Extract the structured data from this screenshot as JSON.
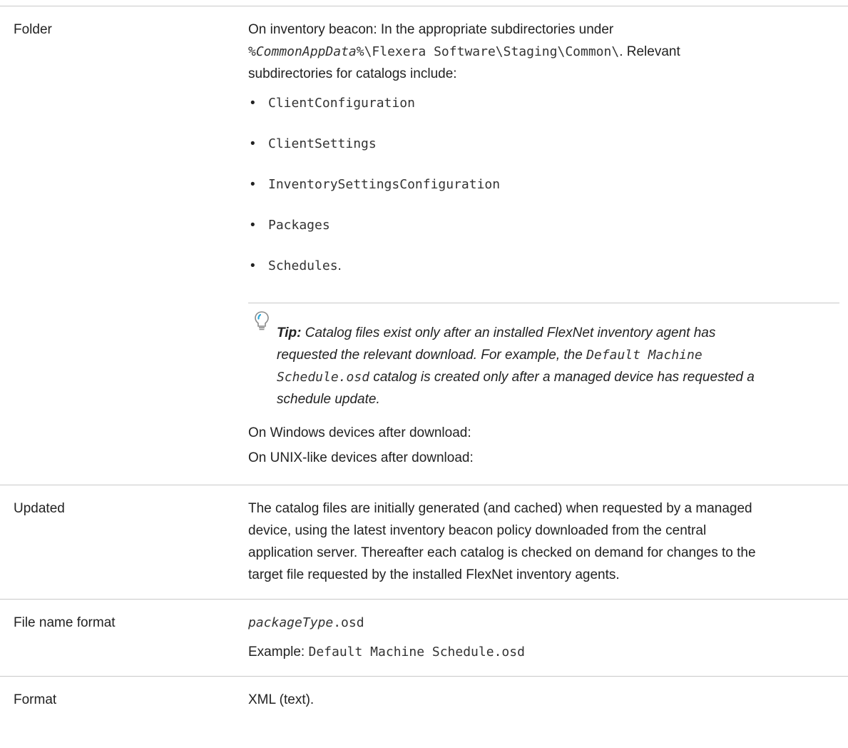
{
  "rows": {
    "folder": {
      "label": "Folder",
      "intro_prefix": "On inventory beacon: In the appropriate subdirectories under",
      "path_var": "%CommonAppData%",
      "path_rest": "\\Flexera Software\\Staging\\Common\\",
      "intro_suffix": ". Relevant",
      "intro_line3": "subdirectories for catalogs include:",
      "subdirs": [
        "ClientConfiguration",
        "ClientSettings",
        "InventorySettingsConfiguration",
        "Packages",
        "Schedules"
      ],
      "last_suffix": ".",
      "tip": {
        "icon": "lightbulb-icon",
        "label": "Tip:",
        "text1": "Catalog files exist only after an installed FlexNet inventory agent has",
        "text2": "requested the relevant download. For example, the",
        "code1": "Default Machine",
        "code2": "Schedule.osd",
        "text3": "catalog is created only after a managed device has requested a",
        "text4": "schedule update."
      },
      "windows_line": "On Windows devices after download:",
      "unix_line": "On UNIX-like devices after download:"
    },
    "updated": {
      "label": "Updated",
      "lines": [
        "The catalog files are initially generated (and cached) when requested by a managed",
        "device, using the latest inventory beacon policy downloaded from the central",
        "application server. Thereafter each catalog is checked on demand for changes to the",
        "target file requested by the installed FlexNet inventory agents."
      ]
    },
    "file_name_format": {
      "label": "File name format",
      "var": "packageType",
      "ext": ".osd",
      "example_label": "Example:",
      "example_value": "Default Machine Schedule.osd"
    },
    "format": {
      "label": "Format",
      "value": "XML (text)."
    }
  }
}
